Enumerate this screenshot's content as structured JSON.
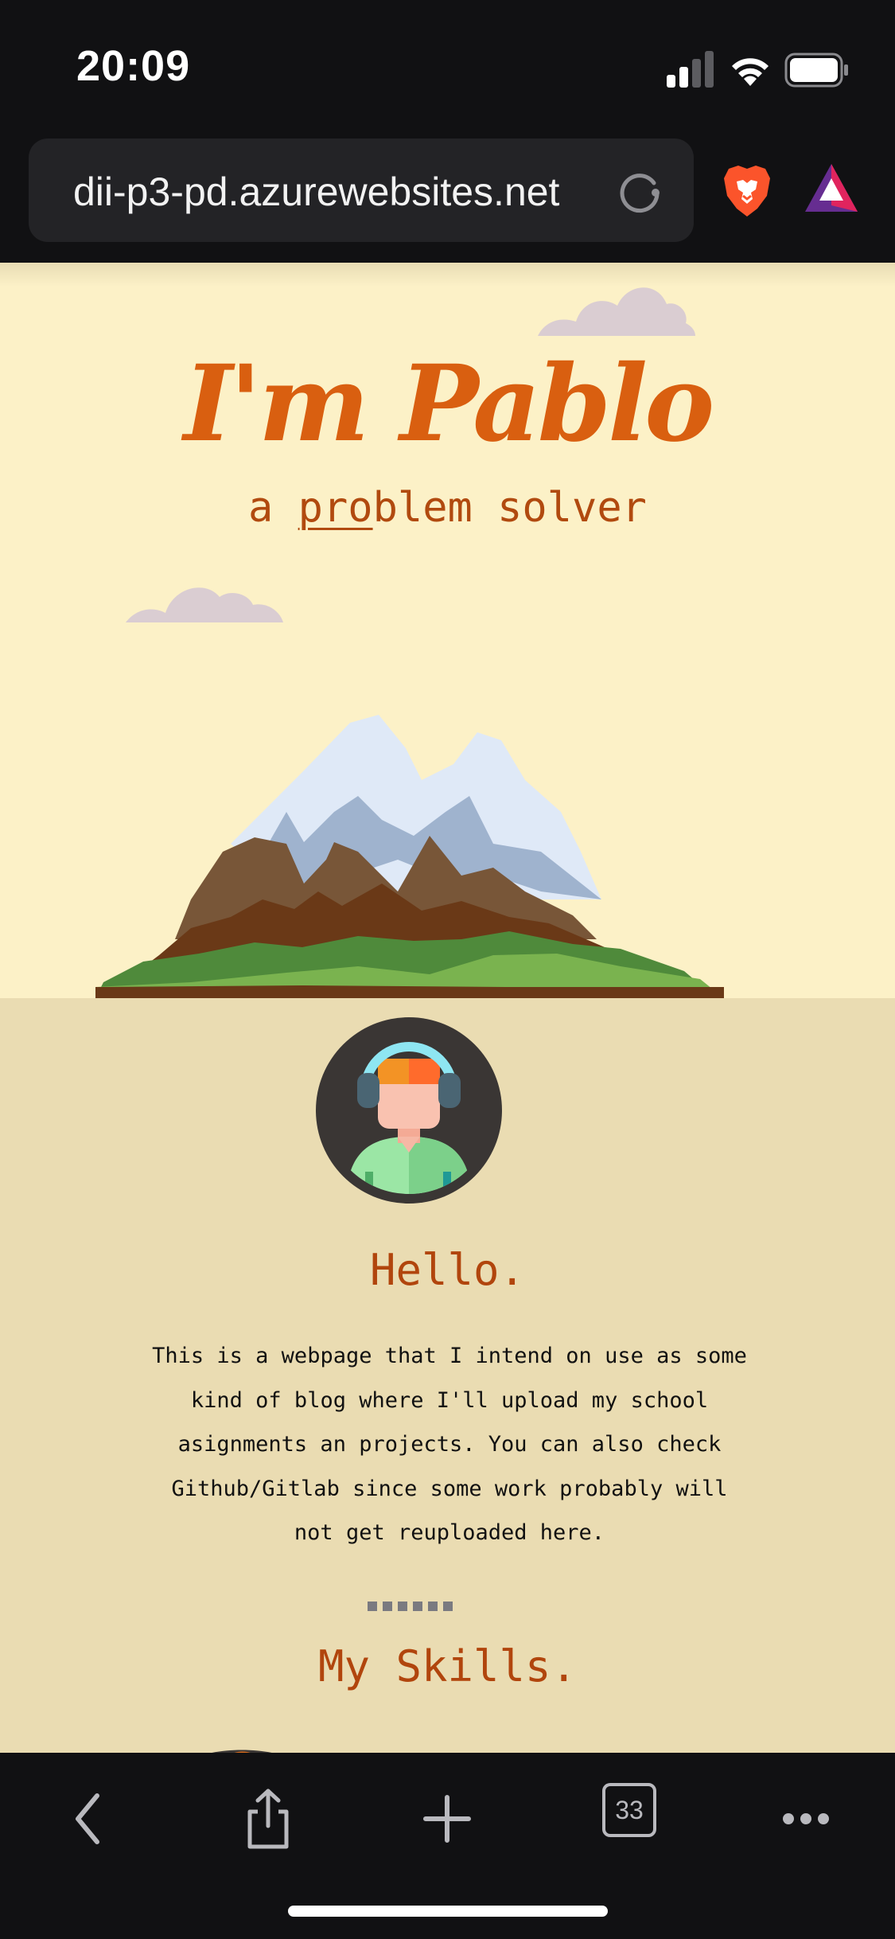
{
  "status_bar": {
    "time": "20:09"
  },
  "browser": {
    "url": "dii-p3-pd.azurewebsites.net",
    "tab_count": "33"
  },
  "page": {
    "hero_title": "I'm Pablo",
    "hero_subtitle_pre": "a ",
    "hero_subtitle_underlined": "pro",
    "hero_subtitle_post": "blem solver",
    "about_heading": "Hello.",
    "about_text": "This is a webpage that I intend on use as some kind of blog where I'll upload my school asignments an projects. You can also check Github/Gitlab since some work probably will not get reuploaded here.",
    "skills_heading": "My Skills."
  },
  "colors": {
    "hero_bg": "#fcf1c7",
    "about_bg": "#eadcb2",
    "accent": "#d95f10",
    "heading": "#b1450d",
    "chrome_bg": "#111113"
  },
  "icons": [
    "signal-icon",
    "wifi-icon",
    "battery-icon",
    "reload-icon",
    "brave-lion-icon",
    "brave-rewards-icon",
    "back-icon",
    "share-icon",
    "add-tab-icon",
    "tabs-icon",
    "more-icon"
  ]
}
